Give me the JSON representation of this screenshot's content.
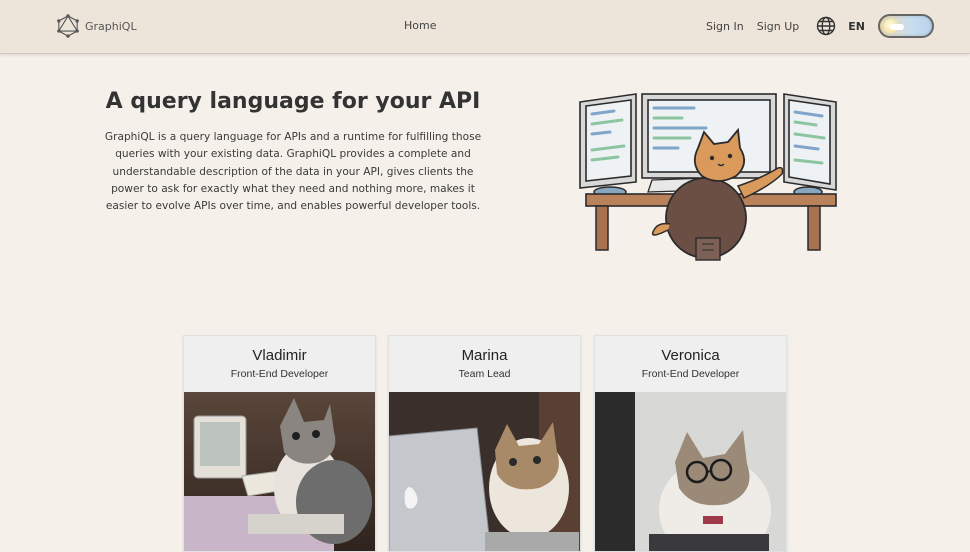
{
  "header": {
    "logo_text": "GraphiQL",
    "nav_home": "Home",
    "sign_in": "Sign In",
    "sign_up": "Sign Up",
    "language": "EN",
    "theme_toggle": "light"
  },
  "hero": {
    "title": "A query language for your API",
    "description_lines": [
      "GraphiQL is a query language for APIs and a runtime for fulfilling those",
      "queries with your existing data. GraphiQL provides a complete and",
      "understandable description of the data in your API, gives clients the",
      "power to ask for exactly what they need and nothing more, makes it",
      "easier to evolve APIs over time, and enables powerful developer tools."
    ]
  },
  "team": [
    {
      "name": "Vladimir",
      "role": "Front-End Developer"
    },
    {
      "name": "Marina",
      "role": "Team Lead"
    },
    {
      "name": "Veronica",
      "role": "Front-End Developer"
    }
  ],
  "colors": {
    "page_bg": "#f5f1ea",
    "header_bg": "#ede5da",
    "card_bg": "#efefef"
  }
}
